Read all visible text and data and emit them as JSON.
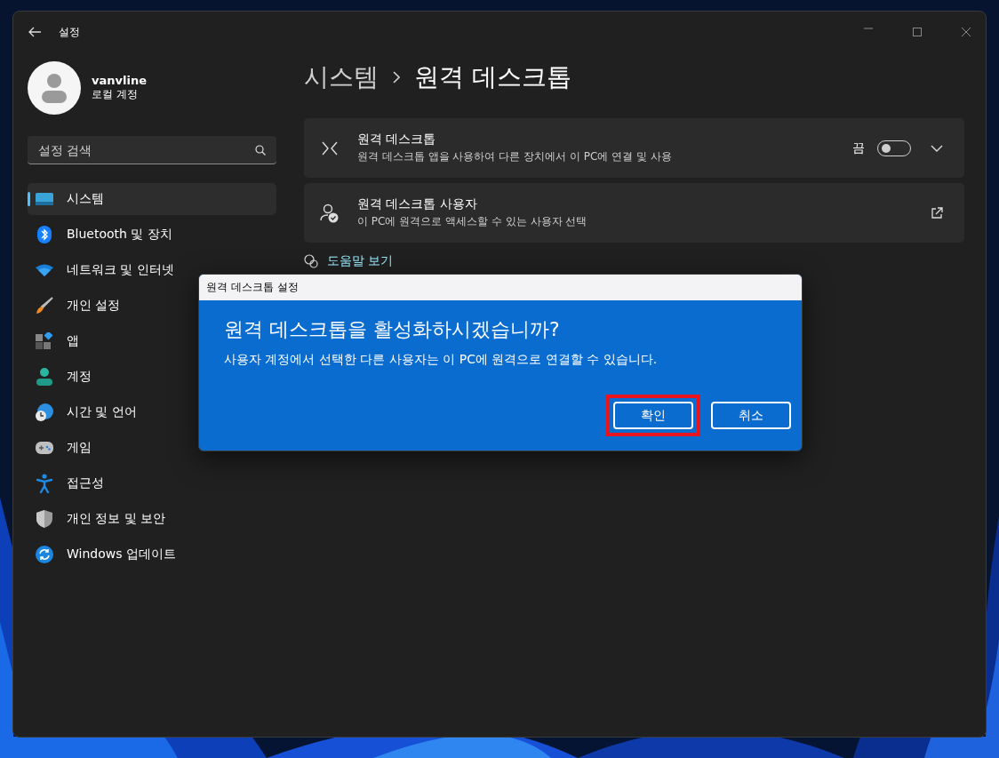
{
  "window": {
    "title": "설정"
  },
  "account": {
    "name": "vanvline",
    "type": "로컬 계정"
  },
  "search": {
    "placeholder": "설정 검색"
  },
  "nav": [
    {
      "label": "시스템",
      "selected": true
    },
    {
      "label": "Bluetooth 및 장치",
      "selected": false
    },
    {
      "label": "네트워크 및 인터넷",
      "selected": false
    },
    {
      "label": "개인 설정",
      "selected": false
    },
    {
      "label": "앱",
      "selected": false
    },
    {
      "label": "계정",
      "selected": false
    },
    {
      "label": "시간 및 언어",
      "selected": false
    },
    {
      "label": "게임",
      "selected": false
    },
    {
      "label": "접근성",
      "selected": false
    },
    {
      "label": "개인 정보 및 보안",
      "selected": false
    },
    {
      "label": "Windows 업데이트",
      "selected": false
    }
  ],
  "breadcrumb": [
    "시스템",
    "원격 데스크톱"
  ],
  "cards": [
    {
      "kind": "toggle",
      "title": "원격 데스크톱",
      "description": "원격 데스크톱 앱을 사용하여 다른 장치에서 이 PC에 연결 및 사용",
      "state_label": "끔",
      "on": false,
      "expanded": false
    },
    {
      "kind": "link",
      "title": "원격 데스크톱 사용자",
      "description": "이 PC에 원격으로 액세스할 수 있는 사용자 선택"
    }
  ],
  "help_link": "도움말 보기",
  "dialog": {
    "title": "원격 데스크톱 설정",
    "heading": "원격 데스크톱을 활성화하시겠습니까?",
    "message": "사용자 계정에서 선택한 다른 사용자는 이 PC에 원격으로 연결할 수 있습니다.",
    "buttons": [
      {
        "label": "확인",
        "highlighted": true
      },
      {
        "label": "취소",
        "highlighted": false
      }
    ]
  }
}
